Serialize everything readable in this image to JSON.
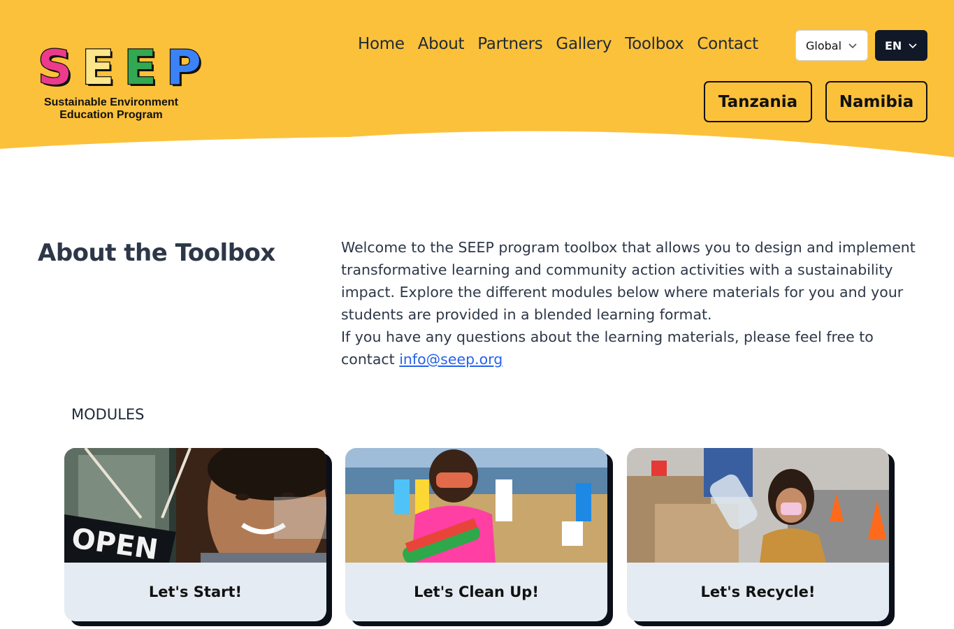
{
  "header": {
    "background_color": "#fcc13a",
    "logo": {
      "letters": [
        "S",
        "E",
        "E",
        "P"
      ],
      "letter_colors": [
        "#ec3a8d",
        "#fde68a",
        "#33a852",
        "#3b82f6"
      ],
      "subtitle_line1": "Sustainable Environment",
      "subtitle_line2": "Education Program"
    },
    "nav": [
      "Home",
      "About",
      "Partners",
      "Gallery",
      "Toolbox",
      "Contact"
    ],
    "region_select": {
      "value": "Global",
      "icon": "chevron-down-icon"
    },
    "language_select": {
      "value": "EN",
      "icon": "chevron-down-icon"
    },
    "country_buttons": [
      "Tanzania",
      "Namibia"
    ]
  },
  "about": {
    "title": "About the Toolbox",
    "paragraph1": "Welcome to the SEEP program toolbox that allows you to design and implement transformative learning and community action activities with a sustainability impact. Explore the different modules below where materials for you and your students are provided in a blended learning format.",
    "paragraph2_prefix": "If you have any questions about the learning materials, please feel free to contact ",
    "email": "info@seep.org"
  },
  "modules": {
    "label": "MODULES",
    "items": [
      {
        "title": "Let's Start!",
        "image": "woman-with-open-sign-photo"
      },
      {
        "title": "Let's Clean Up!",
        "image": "beach-cleanup-photo"
      },
      {
        "title": "Let's Recycle!",
        "image": "girl-recycling-bottle-photo"
      }
    ]
  }
}
